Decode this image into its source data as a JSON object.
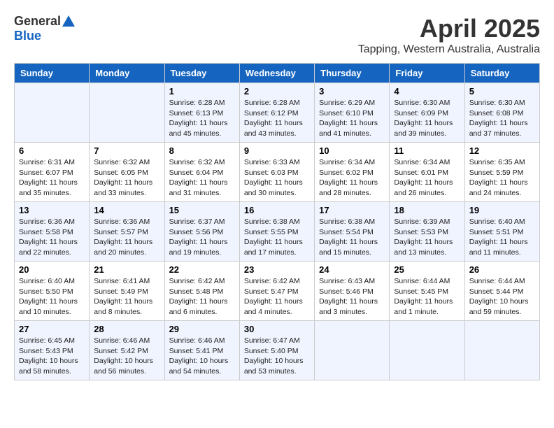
{
  "header": {
    "logo_general": "General",
    "logo_blue": "Blue",
    "month_title": "April 2025",
    "location": "Tapping, Western Australia, Australia"
  },
  "weekdays": [
    "Sunday",
    "Monday",
    "Tuesday",
    "Wednesday",
    "Thursday",
    "Friday",
    "Saturday"
  ],
  "weeks": [
    [
      {
        "day": "",
        "sunrise": "",
        "sunset": "",
        "daylight": ""
      },
      {
        "day": "",
        "sunrise": "",
        "sunset": "",
        "daylight": ""
      },
      {
        "day": "1",
        "sunrise": "Sunrise: 6:28 AM",
        "sunset": "Sunset: 6:13 PM",
        "daylight": "Daylight: 11 hours and 45 minutes."
      },
      {
        "day": "2",
        "sunrise": "Sunrise: 6:28 AM",
        "sunset": "Sunset: 6:12 PM",
        "daylight": "Daylight: 11 hours and 43 minutes."
      },
      {
        "day": "3",
        "sunrise": "Sunrise: 6:29 AM",
        "sunset": "Sunset: 6:10 PM",
        "daylight": "Daylight: 11 hours and 41 minutes."
      },
      {
        "day": "4",
        "sunrise": "Sunrise: 6:30 AM",
        "sunset": "Sunset: 6:09 PM",
        "daylight": "Daylight: 11 hours and 39 minutes."
      },
      {
        "day": "5",
        "sunrise": "Sunrise: 6:30 AM",
        "sunset": "Sunset: 6:08 PM",
        "daylight": "Daylight: 11 hours and 37 minutes."
      }
    ],
    [
      {
        "day": "6",
        "sunrise": "Sunrise: 6:31 AM",
        "sunset": "Sunset: 6:07 PM",
        "daylight": "Daylight: 11 hours and 35 minutes."
      },
      {
        "day": "7",
        "sunrise": "Sunrise: 6:32 AM",
        "sunset": "Sunset: 6:05 PM",
        "daylight": "Daylight: 11 hours and 33 minutes."
      },
      {
        "day": "8",
        "sunrise": "Sunrise: 6:32 AM",
        "sunset": "Sunset: 6:04 PM",
        "daylight": "Daylight: 11 hours and 31 minutes."
      },
      {
        "day": "9",
        "sunrise": "Sunrise: 6:33 AM",
        "sunset": "Sunset: 6:03 PM",
        "daylight": "Daylight: 11 hours and 30 minutes."
      },
      {
        "day": "10",
        "sunrise": "Sunrise: 6:34 AM",
        "sunset": "Sunset: 6:02 PM",
        "daylight": "Daylight: 11 hours and 28 minutes."
      },
      {
        "day": "11",
        "sunrise": "Sunrise: 6:34 AM",
        "sunset": "Sunset: 6:01 PM",
        "daylight": "Daylight: 11 hours and 26 minutes."
      },
      {
        "day": "12",
        "sunrise": "Sunrise: 6:35 AM",
        "sunset": "Sunset: 5:59 PM",
        "daylight": "Daylight: 11 hours and 24 minutes."
      }
    ],
    [
      {
        "day": "13",
        "sunrise": "Sunrise: 6:36 AM",
        "sunset": "Sunset: 5:58 PM",
        "daylight": "Daylight: 11 hours and 22 minutes."
      },
      {
        "day": "14",
        "sunrise": "Sunrise: 6:36 AM",
        "sunset": "Sunset: 5:57 PM",
        "daylight": "Daylight: 11 hours and 20 minutes."
      },
      {
        "day": "15",
        "sunrise": "Sunrise: 6:37 AM",
        "sunset": "Sunset: 5:56 PM",
        "daylight": "Daylight: 11 hours and 19 minutes."
      },
      {
        "day": "16",
        "sunrise": "Sunrise: 6:38 AM",
        "sunset": "Sunset: 5:55 PM",
        "daylight": "Daylight: 11 hours and 17 minutes."
      },
      {
        "day": "17",
        "sunrise": "Sunrise: 6:38 AM",
        "sunset": "Sunset: 5:54 PM",
        "daylight": "Daylight: 11 hours and 15 minutes."
      },
      {
        "day": "18",
        "sunrise": "Sunrise: 6:39 AM",
        "sunset": "Sunset: 5:53 PM",
        "daylight": "Daylight: 11 hours and 13 minutes."
      },
      {
        "day": "19",
        "sunrise": "Sunrise: 6:40 AM",
        "sunset": "Sunset: 5:51 PM",
        "daylight": "Daylight: 11 hours and 11 minutes."
      }
    ],
    [
      {
        "day": "20",
        "sunrise": "Sunrise: 6:40 AM",
        "sunset": "Sunset: 5:50 PM",
        "daylight": "Daylight: 11 hours and 10 minutes."
      },
      {
        "day": "21",
        "sunrise": "Sunrise: 6:41 AM",
        "sunset": "Sunset: 5:49 PM",
        "daylight": "Daylight: 11 hours and 8 minutes."
      },
      {
        "day": "22",
        "sunrise": "Sunrise: 6:42 AM",
        "sunset": "Sunset: 5:48 PM",
        "daylight": "Daylight: 11 hours and 6 minutes."
      },
      {
        "day": "23",
        "sunrise": "Sunrise: 6:42 AM",
        "sunset": "Sunset: 5:47 PM",
        "daylight": "Daylight: 11 hours and 4 minutes."
      },
      {
        "day": "24",
        "sunrise": "Sunrise: 6:43 AM",
        "sunset": "Sunset: 5:46 PM",
        "daylight": "Daylight: 11 hours and 3 minutes."
      },
      {
        "day": "25",
        "sunrise": "Sunrise: 6:44 AM",
        "sunset": "Sunset: 5:45 PM",
        "daylight": "Daylight: 11 hours and 1 minute."
      },
      {
        "day": "26",
        "sunrise": "Sunrise: 6:44 AM",
        "sunset": "Sunset: 5:44 PM",
        "daylight": "Daylight: 10 hours and 59 minutes."
      }
    ],
    [
      {
        "day": "27",
        "sunrise": "Sunrise: 6:45 AM",
        "sunset": "Sunset: 5:43 PM",
        "daylight": "Daylight: 10 hours and 58 minutes."
      },
      {
        "day": "28",
        "sunrise": "Sunrise: 6:46 AM",
        "sunset": "Sunset: 5:42 PM",
        "daylight": "Daylight: 10 hours and 56 minutes."
      },
      {
        "day": "29",
        "sunrise": "Sunrise: 6:46 AM",
        "sunset": "Sunset: 5:41 PM",
        "daylight": "Daylight: 10 hours and 54 minutes."
      },
      {
        "day": "30",
        "sunrise": "Sunrise: 6:47 AM",
        "sunset": "Sunset: 5:40 PM",
        "daylight": "Daylight: 10 hours and 53 minutes."
      },
      {
        "day": "",
        "sunrise": "",
        "sunset": "",
        "daylight": ""
      },
      {
        "day": "",
        "sunrise": "",
        "sunset": "",
        "daylight": ""
      },
      {
        "day": "",
        "sunrise": "",
        "sunset": "",
        "daylight": ""
      }
    ]
  ]
}
